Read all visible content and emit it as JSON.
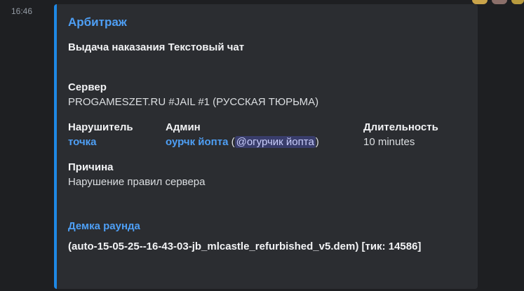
{
  "message": {
    "timestamp": "16:46"
  },
  "embed": {
    "accent_color": "#1e88e5",
    "title": "Арбитраж",
    "description": "Выдача наказания Текстовый чат",
    "fields": {
      "server": {
        "name": "Сервер",
        "value": "PROGAMESZET.RU #JAIL #1 (РУССКАЯ ТЮРЬМА)"
      },
      "violator": {
        "name": "Нарушитель",
        "value": "точка"
      },
      "admin": {
        "name": "Админ",
        "value": "оурчк йопта",
        "open_paren": "(",
        "mention": "@огурчик йопта",
        "close_paren": ")"
      },
      "duration": {
        "name": "Длительность",
        "value": "10 minutes"
      },
      "reason": {
        "name": "Причина",
        "value": "Нарушение правил сервера"
      }
    },
    "demo": {
      "title": "Демка раунда",
      "value": "(auto-15-05-25--16-43-03-jb_mlcastle_refurbished_v5.dem) [тик: 14586]"
    }
  },
  "colors": {
    "background": "#1e1f22",
    "embed_background": "#2b2d31",
    "link": "#4e9ff5",
    "mention_text": "#c9cdfb"
  }
}
